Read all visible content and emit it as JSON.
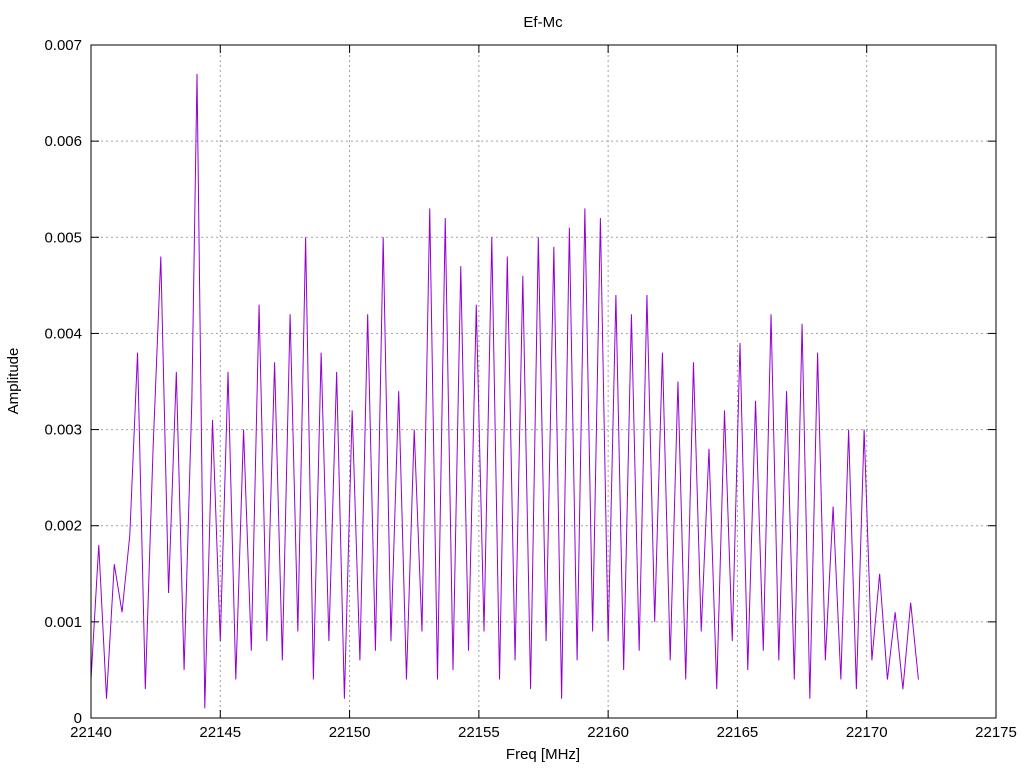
{
  "chart_data": {
    "type": "line",
    "title": "Ef-Mc",
    "xlabel": "Freq [MHz]",
    "ylabel": "Amplitude",
    "xlim": [
      22140,
      22175
    ],
    "ylim": [
      0,
      0.007
    ],
    "grid": true,
    "x_ticks": [
      22140,
      22145,
      22150,
      22155,
      22160,
      22165,
      22170,
      22175
    ],
    "x_tick_labels": [
      "22140",
      "22145",
      "22150",
      "22155",
      "22160",
      "22165",
      "22170",
      "22175"
    ],
    "y_ticks": [
      0,
      0.001,
      0.002,
      0.003,
      0.004,
      0.005,
      0.006,
      0.007
    ],
    "y_tick_labels": [
      "0",
      "0.001",
      "0.002",
      "0.003",
      "0.004",
      "0.005",
      "0.006",
      "0.007"
    ],
    "series": [
      {
        "color": "#9400d3",
        "x": [
          22140.0,
          22140.3,
          22140.6,
          22140.9,
          22141.2,
          22141.5,
          22141.8,
          22142.1,
          22142.4,
          22142.7,
          22143.0,
          22143.3,
          22143.6,
          22143.9,
          22144.1,
          22144.4,
          22144.7,
          22145.0,
          22145.3,
          22145.6,
          22145.9,
          22146.2,
          22146.5,
          22146.8,
          22147.1,
          22147.4,
          22147.7,
          22148.0,
          22148.3,
          22148.6,
          22148.9,
          22149.2,
          22149.5,
          22149.8,
          22150.1,
          22150.4,
          22150.7,
          22151.0,
          22151.3,
          22151.6,
          22151.9,
          22152.2,
          22152.5,
          22152.8,
          22153.1,
          22153.4,
          22153.7,
          22154.0,
          22154.3,
          22154.6,
          22154.9,
          22155.2,
          22155.5,
          22155.8,
          22156.1,
          22156.4,
          22156.7,
          22157.0,
          22157.3,
          22157.6,
          22157.9,
          22158.2,
          22158.5,
          22158.8,
          22159.1,
          22159.4,
          22159.7,
          22160.0,
          22160.3,
          22160.6,
          22160.9,
          22161.2,
          22161.5,
          22161.8,
          22162.1,
          22162.4,
          22162.7,
          22163.0,
          22163.3,
          22163.6,
          22163.9,
          22164.2,
          22164.5,
          22164.8,
          22165.1,
          22165.4,
          22165.7,
          22166.0,
          22166.3,
          22166.6,
          22166.9,
          22167.2,
          22167.5,
          22167.8,
          22168.1,
          22168.4,
          22168.7,
          22169.0,
          22169.3,
          22169.6,
          22169.9,
          22170.2,
          22170.5,
          22170.8,
          22171.1,
          22171.4,
          22171.7,
          22172.0
        ],
        "y": [
          0.0004,
          0.0018,
          0.0002,
          0.0016,
          0.0011,
          0.0019,
          0.0038,
          0.0003,
          0.0028,
          0.0048,
          0.0013,
          0.0036,
          0.0005,
          0.0033,
          0.0067,
          0.0001,
          0.0031,
          0.0008,
          0.0036,
          0.0004,
          0.003,
          0.0007,
          0.0043,
          0.0008,
          0.0037,
          0.0006,
          0.0042,
          0.0009,
          0.005,
          0.0004,
          0.0038,
          0.0008,
          0.0036,
          0.0002,
          0.0032,
          0.0006,
          0.0042,
          0.0007,
          0.005,
          0.0008,
          0.0034,
          0.0004,
          0.003,
          0.0009,
          0.0053,
          0.0004,
          0.0052,
          0.0005,
          0.0047,
          0.0007,
          0.0043,
          0.0009,
          0.005,
          0.0004,
          0.0048,
          0.0006,
          0.0046,
          0.0003,
          0.005,
          0.0008,
          0.0049,
          0.0002,
          0.0051,
          0.0006,
          0.0053,
          0.0009,
          0.0052,
          0.0008,
          0.0044,
          0.0005,
          0.0042,
          0.0007,
          0.0044,
          0.001,
          0.0038,
          0.0006,
          0.0035,
          0.0004,
          0.0037,
          0.0009,
          0.0028,
          0.0003,
          0.0032,
          0.0008,
          0.0039,
          0.0005,
          0.0033,
          0.0007,
          0.0042,
          0.0006,
          0.0034,
          0.0004,
          0.0041,
          0.0002,
          0.0038,
          0.0006,
          0.0022,
          0.0004,
          0.003,
          0.0003,
          0.003,
          0.0006,
          0.0015,
          0.0004,
          0.0011,
          0.0003,
          0.0012,
          0.0004
        ]
      }
    ]
  }
}
